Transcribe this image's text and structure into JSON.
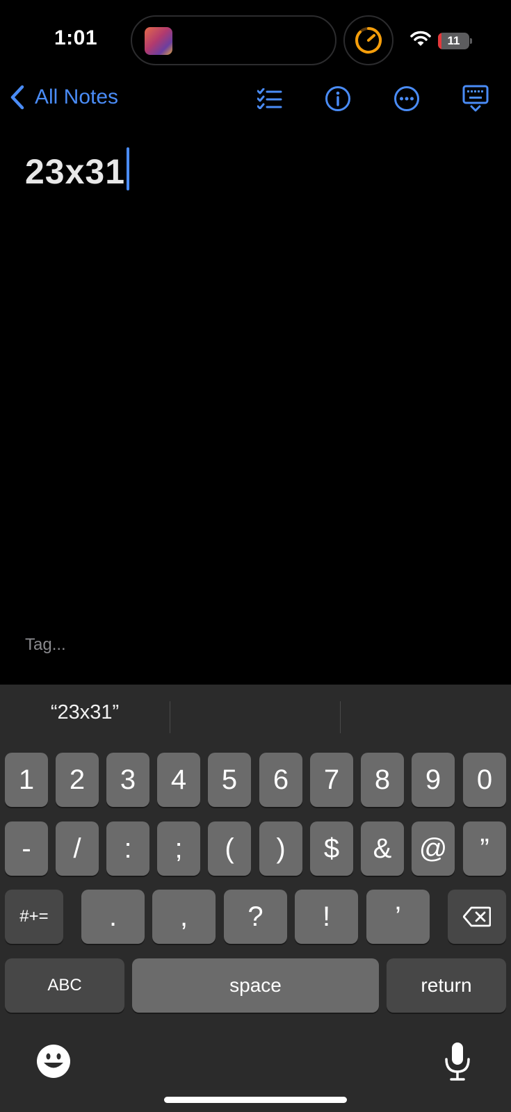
{
  "status_bar": {
    "time": "1:01",
    "battery_level": "11",
    "battery_color": "#e5383b"
  },
  "nav": {
    "back_label": "All Notes",
    "accent": "#4a8cf7",
    "icons": [
      "checklist-icon",
      "info-icon",
      "more-icon",
      "keyboard-dismiss-icon"
    ]
  },
  "note": {
    "title": "23x31",
    "tag_placeholder": "Tag..."
  },
  "keyboard": {
    "suggestions": [
      "“23x31”",
      "",
      ""
    ],
    "row1": [
      "1",
      "2",
      "3",
      "4",
      "5",
      "6",
      "7",
      "8",
      "9",
      "0"
    ],
    "row2": [
      "-",
      "/",
      ":",
      ";",
      "(",
      ")",
      "$",
      "&",
      "@",
      "”"
    ],
    "row3": {
      "shift_label": "#+=",
      "keys": [
        ".",
        ",",
        "?",
        "!",
        "’"
      ]
    },
    "row4": {
      "abc_label": "ABC",
      "space_label": "space",
      "return_label": "return"
    }
  }
}
